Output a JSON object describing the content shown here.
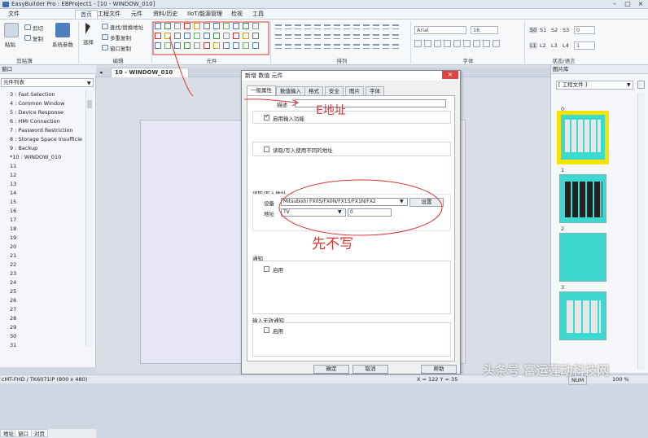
{
  "app": {
    "title": "EasyBuilder Pro : EBProject1 - [10 - WINDOW_010]"
  },
  "menu": [
    "文件",
    "工程文件",
    "首页",
    "元件",
    "资料/历史",
    "IIoT/能源管理",
    "检视",
    "工具"
  ],
  "ribbon": {
    "paste": "粘贴",
    "cut": "剪切",
    "copy": "复制",
    "system_params": "系统参数",
    "select": "选择",
    "find_replace": "查找/替换地址",
    "multi_copy": "多重复制",
    "window_copy": "窗口复制",
    "groups": [
      "剪贴簿",
      "编辑",
      "元件",
      "排列",
      "字体",
      "状态/语言"
    ],
    "font_name": "Arial",
    "font_size": "16",
    "states_row1": [
      "S0",
      "S1",
      "S2",
      "S3"
    ],
    "states_row2": [
      "L1",
      "L2",
      "L3",
      "L4"
    ],
    "state_value1": "0",
    "state_value2": "1"
  },
  "left_panel": {
    "header": "窗口",
    "combo": "元件列表",
    "items": [
      "3 : Fast Selection",
      "4 : Common Window",
      "5 : Device Response",
      "6 : HMI Connection",
      "7 : Password Restriction",
      "8 : Storage Space Insufficie",
      "9 : Backup",
      "*10 : WINDOW_010",
      "11",
      "12",
      "13",
      "14",
      "15",
      "16",
      "17",
      "18",
      "19",
      "20",
      "21",
      "22",
      "23",
      "24",
      "25",
      "26",
      "27",
      "28",
      "29",
      "30",
      "31"
    ],
    "tabs": [
      "地址",
      "窗口",
      "对页"
    ]
  },
  "editor": {
    "tab": "10 - WINDOW_010"
  },
  "right_panel": {
    "header": "图片库",
    "combo": "[ 工程文件 ]",
    "thumbs": [
      "0",
      "1",
      "2",
      "3"
    ]
  },
  "dialog": {
    "title": "新增 数值 元件",
    "tabs": [
      "一般属性",
      "数值输入",
      "格式",
      "安全",
      "图片",
      "字体"
    ],
    "comment_label": "描述",
    "enable_input": "启用输入功能",
    "read_write_diff": "读取/写入使用不同的地址",
    "rw_address_label": "读取/写入地址",
    "device_label": "设备",
    "device_value": "Mitsubishi FX0S/FX0N/FX1S/FX1N/FX2",
    "settings_button": "设置",
    "address_label": "地址",
    "address_type": "TV",
    "address_value": "0",
    "notify_label": "通知",
    "enable": "启用",
    "invalid_notify_label": "输入无效通知",
    "enable2": "启用",
    "ok": "确定",
    "cancel": "取消",
    "help": "帮助"
  },
  "annotations": {
    "address_note": "E地址",
    "no_write_note": "先不写"
  },
  "status": {
    "model": "cMT-FHD / TK6071iP (800 x 480)",
    "coords": "X = 122   Y = 35",
    "num": "NUM",
    "zoom": "100 %"
  },
  "watermark": "头条号 富运莲动科技网"
}
